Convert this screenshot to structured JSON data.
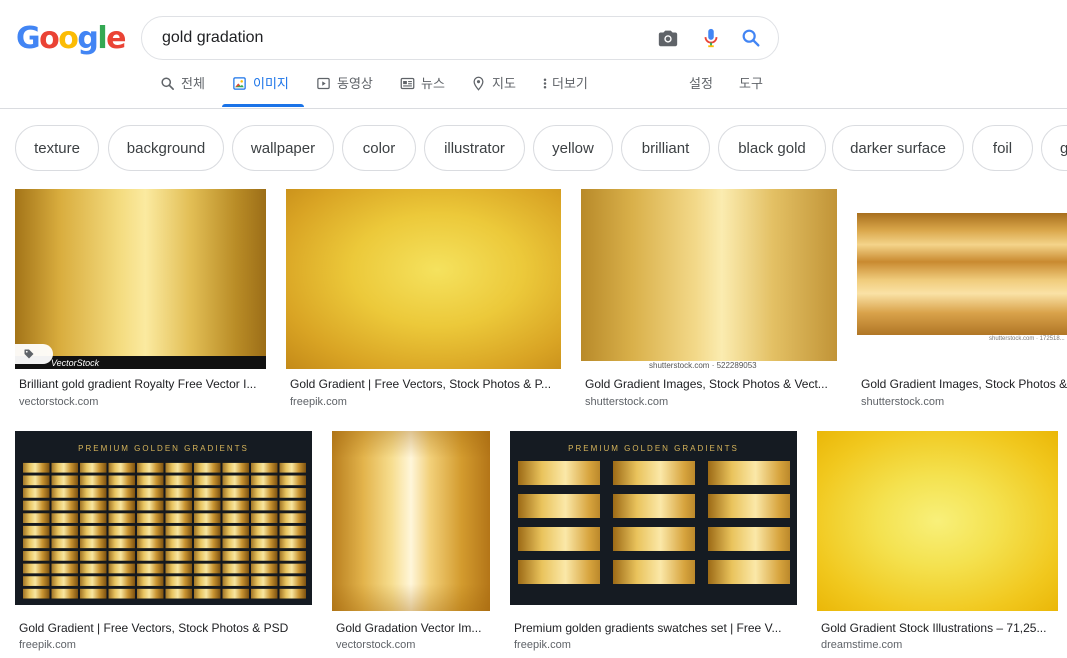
{
  "logo": [
    "G",
    "o",
    "o",
    "g",
    "l",
    "e"
  ],
  "logo_colors": [
    "#4285F4",
    "#EA4335",
    "#FBBC05",
    "#4285F4",
    "#34A853",
    "#EA4335"
  ],
  "search": {
    "query": "gold gradation"
  },
  "icons": {
    "camera": "camera-icon",
    "mic": "mic-icon",
    "search": "search-icon"
  },
  "tabs": [
    {
      "label": "전체",
      "icon": "search-icon"
    },
    {
      "label": "이미지",
      "icon": "image-icon",
      "active": true
    },
    {
      "label": "동영상",
      "icon": "video-icon"
    },
    {
      "label": "뉴스",
      "icon": "news-icon"
    },
    {
      "label": "지도",
      "icon": "map-pin-icon"
    },
    {
      "label": "더보기",
      "icon": "more-vert-icon"
    }
  ],
  "tools": {
    "settings": "설정",
    "tools": "도구"
  },
  "chips": [
    "texture",
    "background",
    "wallpaper",
    "color",
    "illustrator",
    "yellow",
    "brilliant",
    "black gold",
    "darker surface",
    "foil",
    "g"
  ],
  "results": [
    {
      "title": "Brilliant gold gradient Royalty Free Vector I...",
      "source": "vectorstock.com",
      "watermark": "VectorStock"
    },
    {
      "title": "Gold Gradient | Free Vectors, Stock Photos & P...",
      "source": "freepik.com"
    },
    {
      "title": "Gold Gradient Images, Stock Photos & Vect...",
      "source": "shutterstock.com",
      "watermark": "shutterstock.com · 522289053"
    },
    {
      "title": "Gold Gradient Images, Stock Photos & V",
      "source": "shutterstock.com",
      "watermark": "shutterstock.com · 172518..."
    },
    {
      "title": "Gold Gradient | Free Vectors, Stock Photos & PSD",
      "source": "freepik.com",
      "label": "PREMIUM GOLDEN GRADIENTS"
    },
    {
      "title": "Gold Gradation Vector Im...",
      "source": "vectorstock.com"
    },
    {
      "title": "Premium golden gradients swatches set | Free V...",
      "source": "freepik.com",
      "label": "PREMIUM GOLDEN GRADIENTS"
    },
    {
      "title": "Gold Gradient Stock Illustrations – 71,25...",
      "source": "dreamstime.com"
    }
  ],
  "colors": {
    "accent": "#1a73e8",
    "gold_light": "#f5e07a",
    "gold_mid": "#d4a52a",
    "gold_dark": "#9a6d14",
    "dark_bg": "#151b22"
  }
}
